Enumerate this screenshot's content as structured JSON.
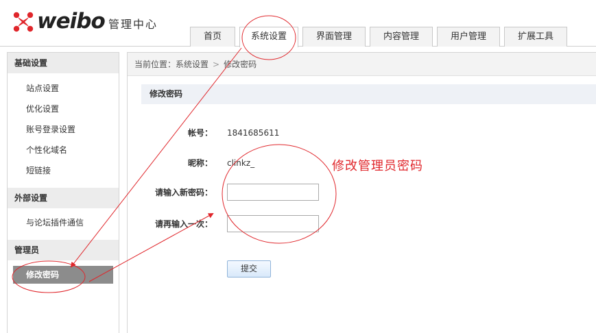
{
  "header": {
    "logo_text": "weibo",
    "logo_sub": "管理中心",
    "tabs": [
      {
        "label": "首页"
      },
      {
        "label": "系统设置"
      },
      {
        "label": "界面管理"
      },
      {
        "label": "内容管理"
      },
      {
        "label": "用户管理"
      },
      {
        "label": "扩展工具"
      }
    ],
    "active_tab": "系统设置"
  },
  "sidebar": {
    "groups": [
      {
        "title": "基础设置",
        "items": [
          "站点设置",
          "优化设置",
          "账号登录设置",
          "个性化域名",
          "短链接"
        ]
      },
      {
        "title": "外部设置",
        "items": [
          "与论坛插件通信"
        ]
      },
      {
        "title": "管理员",
        "items": [
          "修改密码"
        ]
      }
    ],
    "active_item": "修改密码"
  },
  "breadcrumb": {
    "prefix": "当前位置：",
    "items": [
      "系统设置",
      "修改密码"
    ],
    "separator": ">"
  },
  "form": {
    "section_title": "修改密码",
    "account_label": "帐号：",
    "account_value": "1841685611",
    "nickname_label": "昵称：",
    "nickname_value": "clinkz_",
    "new_password_label": "请输入新密码：",
    "new_password_value": "",
    "confirm_password_label": "请再输入一次：",
    "confirm_password_value": "",
    "submit_label": "提交"
  },
  "annotation": {
    "text": "修改管理员密码",
    "color": "#e0262b"
  },
  "colors": {
    "logo_red": "#e0262b",
    "sidebar_active_bg": "#8c8c8c",
    "section_bg": "#eef1f6"
  }
}
